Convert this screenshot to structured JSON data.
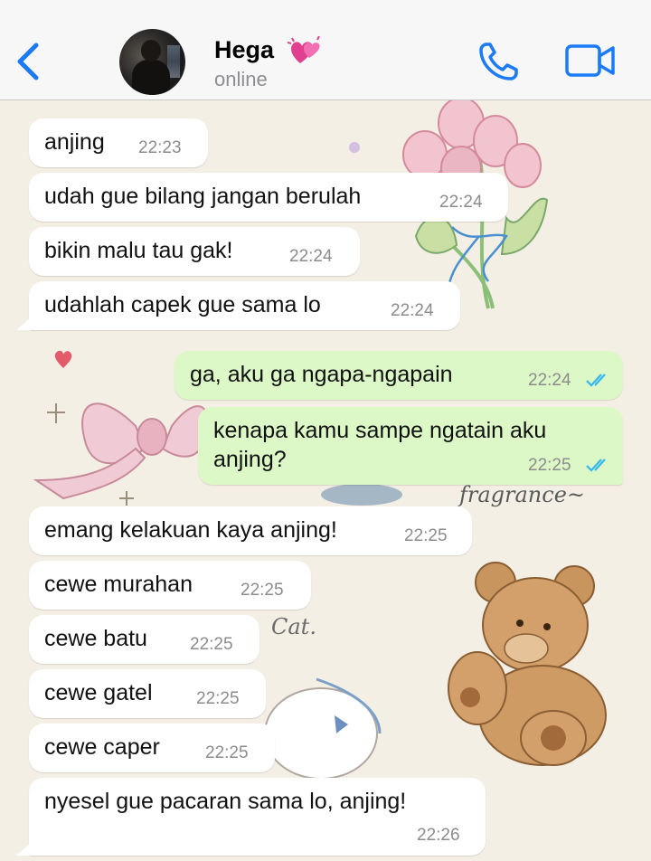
{
  "header": {
    "contact_name": "Hega",
    "heart_icon": "💞",
    "status": "online",
    "accent_color": "#1a7af8"
  },
  "messages": [
    {
      "dir": "in",
      "text": "anjing",
      "time": "22:23"
    },
    {
      "dir": "in",
      "text": "udah gue bilang jangan berulah",
      "time": "22:24"
    },
    {
      "dir": "in",
      "text": "bikin malu tau gak!",
      "time": "22:24"
    },
    {
      "dir": "in",
      "text": "udahlah capek gue sama lo",
      "time": "22:24"
    },
    {
      "dir": "out",
      "text": "ga, aku ga ngapa-ngapain",
      "time": "22:24",
      "read": true
    },
    {
      "dir": "out",
      "text_line1": "kenapa kamu sampe ngatain aku",
      "text_line2": "anjing?",
      "time": "22:25",
      "read": true
    },
    {
      "dir": "in",
      "text": "emang kelakuan kaya anjing!",
      "time": "22:25"
    },
    {
      "dir": "in",
      "text": "cewe murahan",
      "time": "22:25"
    },
    {
      "dir": "in",
      "text": "cewe batu",
      "time": "22:25"
    },
    {
      "dir": "in",
      "text": "cewe gatel",
      "time": "22:25"
    },
    {
      "dir": "in",
      "text": "cewe caper",
      "time": "22:25"
    },
    {
      "dir": "in",
      "text": "nyesel gue pacaran sama lo, anjing!",
      "time": "22:26"
    }
  ],
  "wallpaper": {
    "text_fragrance": "fragrance~",
    "text_cat": "Cat."
  }
}
